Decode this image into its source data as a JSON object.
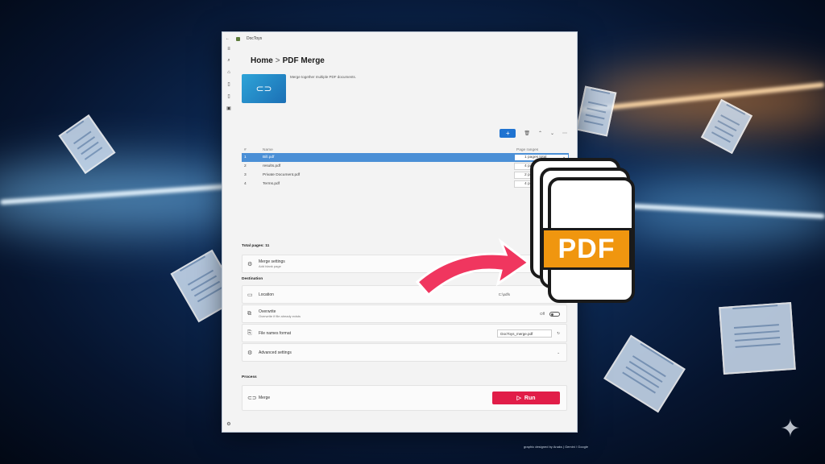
{
  "window": {
    "title": "DocToys",
    "breadcrumb_home": "Home",
    "breadcrumb_sep": ">",
    "breadcrumb_page": "PDF Merge",
    "description": "Merge together multiple PDF documents."
  },
  "table": {
    "col_num": "#",
    "col_name": "Name",
    "col_range": "Page ranges",
    "rows": [
      {
        "num": "1",
        "name": "Bill.pdf",
        "range": "1 pages total"
      },
      {
        "num": "2",
        "name": "results.pdf",
        "range": "4 pages total"
      },
      {
        "num": "3",
        "name": "Private Document.pdf",
        "range": "2 pages total"
      },
      {
        "num": "4",
        "name": "Terms.pdf",
        "range": "4 pages total"
      }
    ]
  },
  "total_pages": "Total pages: 11",
  "merge_settings": {
    "title": "Merge settings",
    "subtitle": "Add blank page"
  },
  "destination": {
    "label": "Destination",
    "location": "Location",
    "location_value": "C:\\pdfs",
    "overwrite": "Overwrite",
    "overwrite_sub": "Overwrite if file already exists",
    "overwrite_state": "Off",
    "file_format": "File names format",
    "file_format_value": "DocToys_merge.pdf",
    "advanced": "Advanced settings"
  },
  "process": {
    "label": "Process",
    "merge": "Merge",
    "run": "Run"
  },
  "overlay": {
    "pdf_label": "PDF",
    "caption": "graphic designed by Anaks | Gemini / Google"
  },
  "colors": {
    "accent": "#1f73d1",
    "run": "#e11d48",
    "pdf_orange": "#f0960f",
    "arrow": "#f0365f"
  }
}
